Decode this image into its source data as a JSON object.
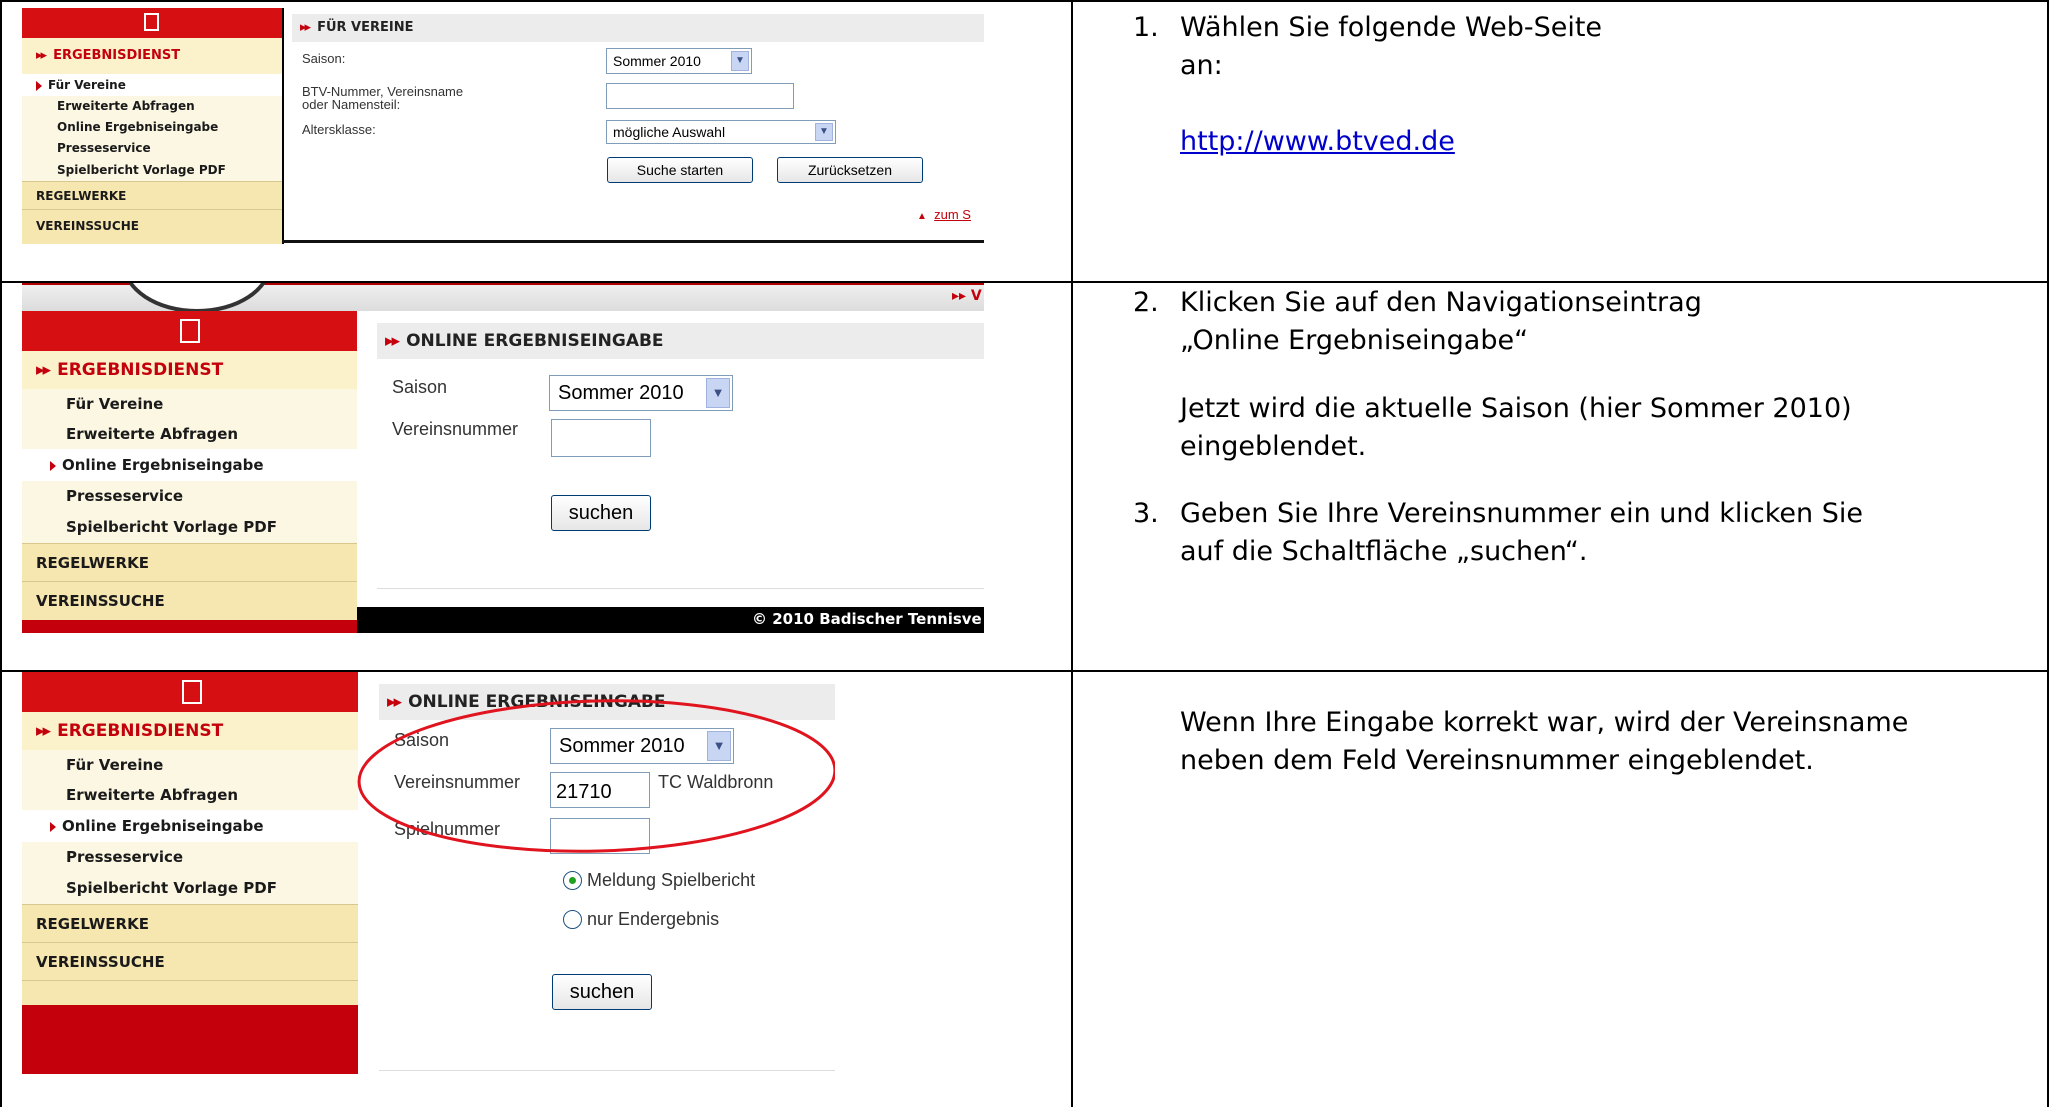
{
  "screenshot1": {
    "nav": {
      "header": "ERGEBNISDIENST",
      "items": [
        "Für Vereine",
        "Erweiterte Abfragen",
        "Online Ergebniseingabe",
        "Presseservice",
        "Spielbericht Vorlage PDF"
      ],
      "sections": [
        "REGELWERKE",
        "VEREINSSUCHE"
      ]
    },
    "form": {
      "title": "FÜR VEREINE",
      "saison_label": "Saison:",
      "saison_value": "Sommer 2010",
      "btv_label_1": "BTV-Nummer, Vereinsname",
      "btv_label_2": "oder Namensteil:",
      "btv_value": "",
      "altersklasse_label": "Altersklasse:",
      "altersklasse_value": "mögliche Auswahl",
      "search_button": "Suche starten",
      "reset_button": "Zurücksetzen",
      "top_link": "zum S"
    }
  },
  "screenshot2": {
    "top_right": "▸▸ V",
    "nav": {
      "header": "ERGEBNISDIENST",
      "items": [
        "Für Vereine",
        "Erweiterte Abfragen",
        "Online Ergebniseingabe",
        "Presseservice",
        "Spielbericht Vorlage PDF"
      ],
      "sections": [
        "REGELWERKE",
        "VEREINSSUCHE"
      ]
    },
    "form": {
      "title": "ONLINE ERGEBNISEINGABE",
      "saison_label": "Saison",
      "saison_value": "Sommer 2010",
      "vereinsnummer_label": "Vereinsnummer",
      "vereinsnummer_value": "",
      "search_button": "suchen"
    },
    "footer": "© 2010 Badischer Tennisve"
  },
  "screenshot3": {
    "nav": {
      "header": "ERGEBNISDIENST",
      "items": [
        "Für Vereine",
        "Erweiterte Abfragen",
        "Online Ergebniseingabe",
        "Presseservice",
        "Spielbericht Vorlage PDF"
      ],
      "sections": [
        "REGELWERKE",
        "VEREINSSUCHE"
      ]
    },
    "form": {
      "title": "ONLINE ERGEBNISEINGABE",
      "saison_label": "Saison",
      "saison_value": "Sommer 2010",
      "vereinsnummer_label": "Vereinsnummer",
      "vereinsnummer_value": "21710",
      "vereinsname": "TC Waldbronn",
      "spielnummer_label": "Spielnummer",
      "spielnummer_value": "",
      "radio1_label": "Meldung Spielbericht",
      "radio2_label": "nur Endergebnis",
      "search_button": "suchen"
    },
    "highlight_color": "#e0141e"
  },
  "instructions": {
    "step1_num": "1.",
    "step1_line1": "Wählen Sie folgende Web-Seite",
    "step1_line2": "an:",
    "step1_link": "http://www.btved.de",
    "step2_num": "2.",
    "step2_line1": "Klicken Sie auf den Navigationseintrag",
    "step2_line2": "„Online Ergebniseingabe“",
    "step2_line3": "Jetzt wird die aktuelle Saison (hier Sommer 2010)",
    "step2_line4": "eingeblendet.",
    "step3_num": "3.",
    "step3_line1": "Geben Sie Ihre Vereinsnummer ein und klicken Sie",
    "step3_line2": "auf die Schaltfläche „suchen“.",
    "step4_line1": "Wenn Ihre Eingabe korrekt war, wird der Vereinsname",
    "step4_line2": "neben dem Feld Vereinsnummer eingeblendet."
  },
  "colors": {
    "brand_red": "#c3000b",
    "nav_bg": "#fbf2cc",
    "link": "#0000cc"
  }
}
